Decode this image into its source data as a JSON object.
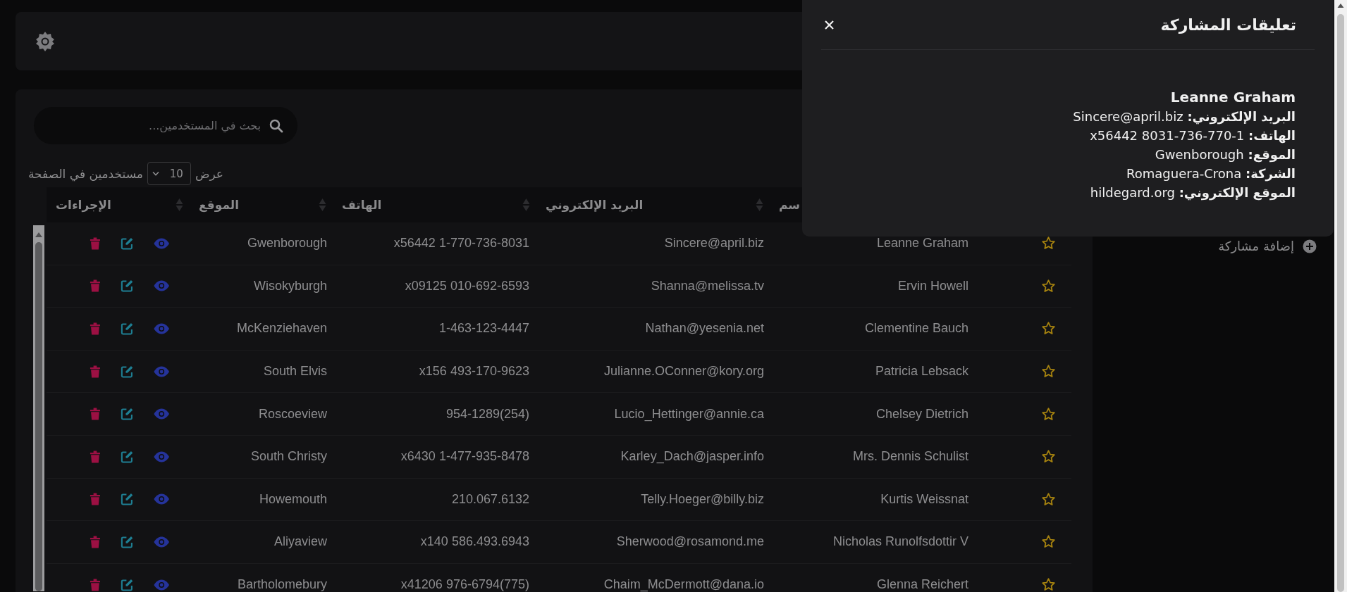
{
  "search": {
    "placeholder": "بحث في المستخدمين..."
  },
  "page_size": {
    "label_before": "عرض",
    "value": "10",
    "label_after": "مستخدمين في الصفحة"
  },
  "table": {
    "columns": [
      {
        "label": "سم",
        "kind": "sortable"
      },
      {
        "label": "البريد الإلكتروني",
        "kind": "sortable"
      },
      {
        "label": "الهاتف",
        "kind": "sortable"
      },
      {
        "label": "الموقع",
        "kind": "sortable"
      },
      {
        "label": "الإجراءات",
        "kind": "plain"
      }
    ],
    "rows": [
      {
        "favorite": false,
        "name": "Leanne Graham",
        "email": "Sincere@april.biz",
        "phone": "1-770-736-8031 x56442",
        "location": "Gwenborough"
      },
      {
        "favorite": false,
        "name": "Ervin Howell",
        "email": "Shanna@melissa.tv",
        "phone": "010-692-6593 x09125",
        "location": "Wisokyburgh"
      },
      {
        "favorite": false,
        "name": "Clementine Bauch",
        "email": "Nathan@yesenia.net",
        "phone": "1-463-123-4447",
        "location": "McKenziehaven"
      },
      {
        "favorite": false,
        "name": "Patricia Lebsack",
        "email": "Julianne.OConner@kory.org",
        "phone": "493-170-9623 x156",
        "location": "South Elvis"
      },
      {
        "favorite": false,
        "name": "Chelsey Dietrich",
        "email": "Lucio_Hettinger@annie.ca",
        "phone": "(254)954-1289",
        "location": "Roscoeview"
      },
      {
        "favorite": false,
        "name": "Mrs. Dennis Schulist",
        "email": "Karley_Dach@jasper.info",
        "phone": "1-477-935-8478 x6430",
        "location": "South Christy"
      },
      {
        "favorite": false,
        "name": "Kurtis Weissnat",
        "email": "Telly.Hoeger@billy.biz",
        "phone": "210.067.6132",
        "location": "Howemouth"
      },
      {
        "favorite": false,
        "name": "Nicholas Runolfsdottir V",
        "email": "Sherwood@rosamond.me",
        "phone": "586.493.6943 x140",
        "location": "Aliyaview"
      },
      {
        "favorite": false,
        "name": "Glenna Reichert",
        "email": "Chaim_McDermott@dana.io",
        "phone": "(775)976-6794 x41206",
        "location": "Bartholomebury"
      }
    ]
  },
  "sidebar": {
    "add_button": "إضافة مشاركة"
  },
  "modal": {
    "title": "تعليقات المشاركة",
    "name": "Leanne Graham",
    "details": [
      "**البريد الإلكتروني:** Sincere@april.biz",
      "**الهاتف:** 1-770-736-8031 x56442",
      "**الموقع:** Gwenborough",
      "**الشركة:** Romaguera-Crona",
      "**الموقع الإلكتروني:** hildegard.org"
    ]
  }
}
